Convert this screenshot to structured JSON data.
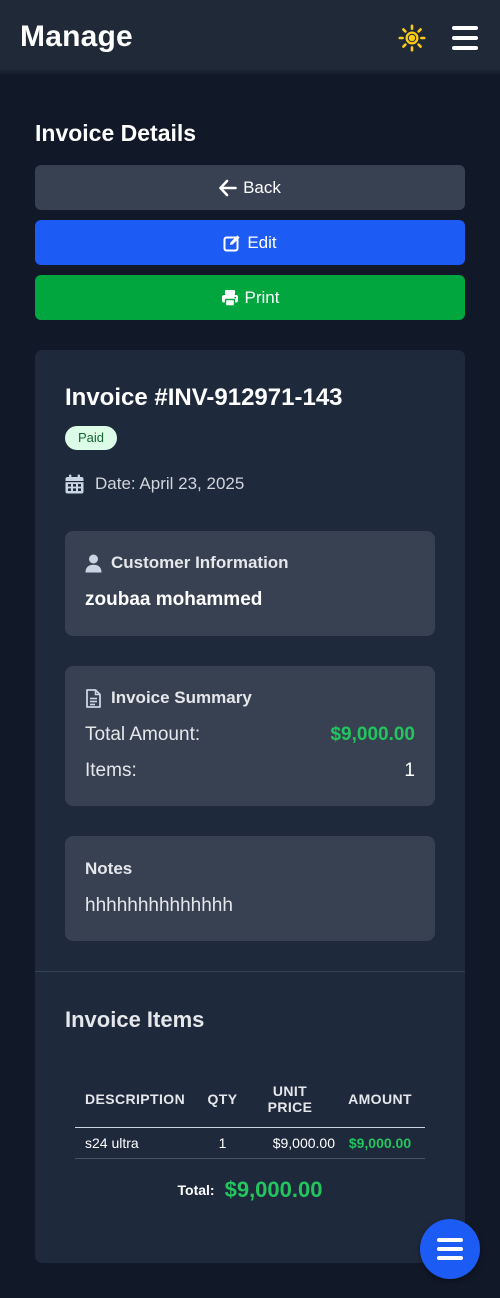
{
  "header": {
    "brand": "Manage",
    "theme_icon": "sun-icon",
    "menu_icon": "hamburger-menu-icon"
  },
  "page": {
    "title": "Invoice Details"
  },
  "actions": {
    "back_label": "Back",
    "edit_label": "Edit",
    "print_label": "Print"
  },
  "invoice": {
    "title": "Invoice #INV-912971-143",
    "status": "Paid",
    "date": "Date: April 23, 2025"
  },
  "customer": {
    "heading": "Customer Information",
    "name": "zoubaa mohammed"
  },
  "summary": {
    "heading": "Invoice Summary",
    "total_label": "Total Amount:",
    "total_value": "$9,000.00",
    "items_label": "Items:",
    "items_value": "1"
  },
  "notes": {
    "heading": "Notes",
    "text": "hhhhhhhhhhhhhh"
  },
  "items": {
    "heading": "Invoice Items",
    "columns": {
      "description": "DESCRIPTION",
      "qty": "QTY",
      "unit_price_line1": "UNIT",
      "unit_price_line2": "PRICE",
      "amount": "AMOUNT"
    },
    "rows": [
      {
        "description": "s24 ultra",
        "qty": "1",
        "unit_price": "$9,000.00",
        "amount": "$9,000.00"
      }
    ],
    "total_label": "Total:",
    "total_value": "$9,000.00"
  },
  "colors": {
    "background": "#111827",
    "header": "#1f2937",
    "card": "#1e293b",
    "panel": "#374151",
    "primary": "#1d5bf5",
    "success": "#01a63f",
    "money": "#22c55e",
    "badge_bg": "#dcfce7",
    "badge_text": "#166534"
  }
}
